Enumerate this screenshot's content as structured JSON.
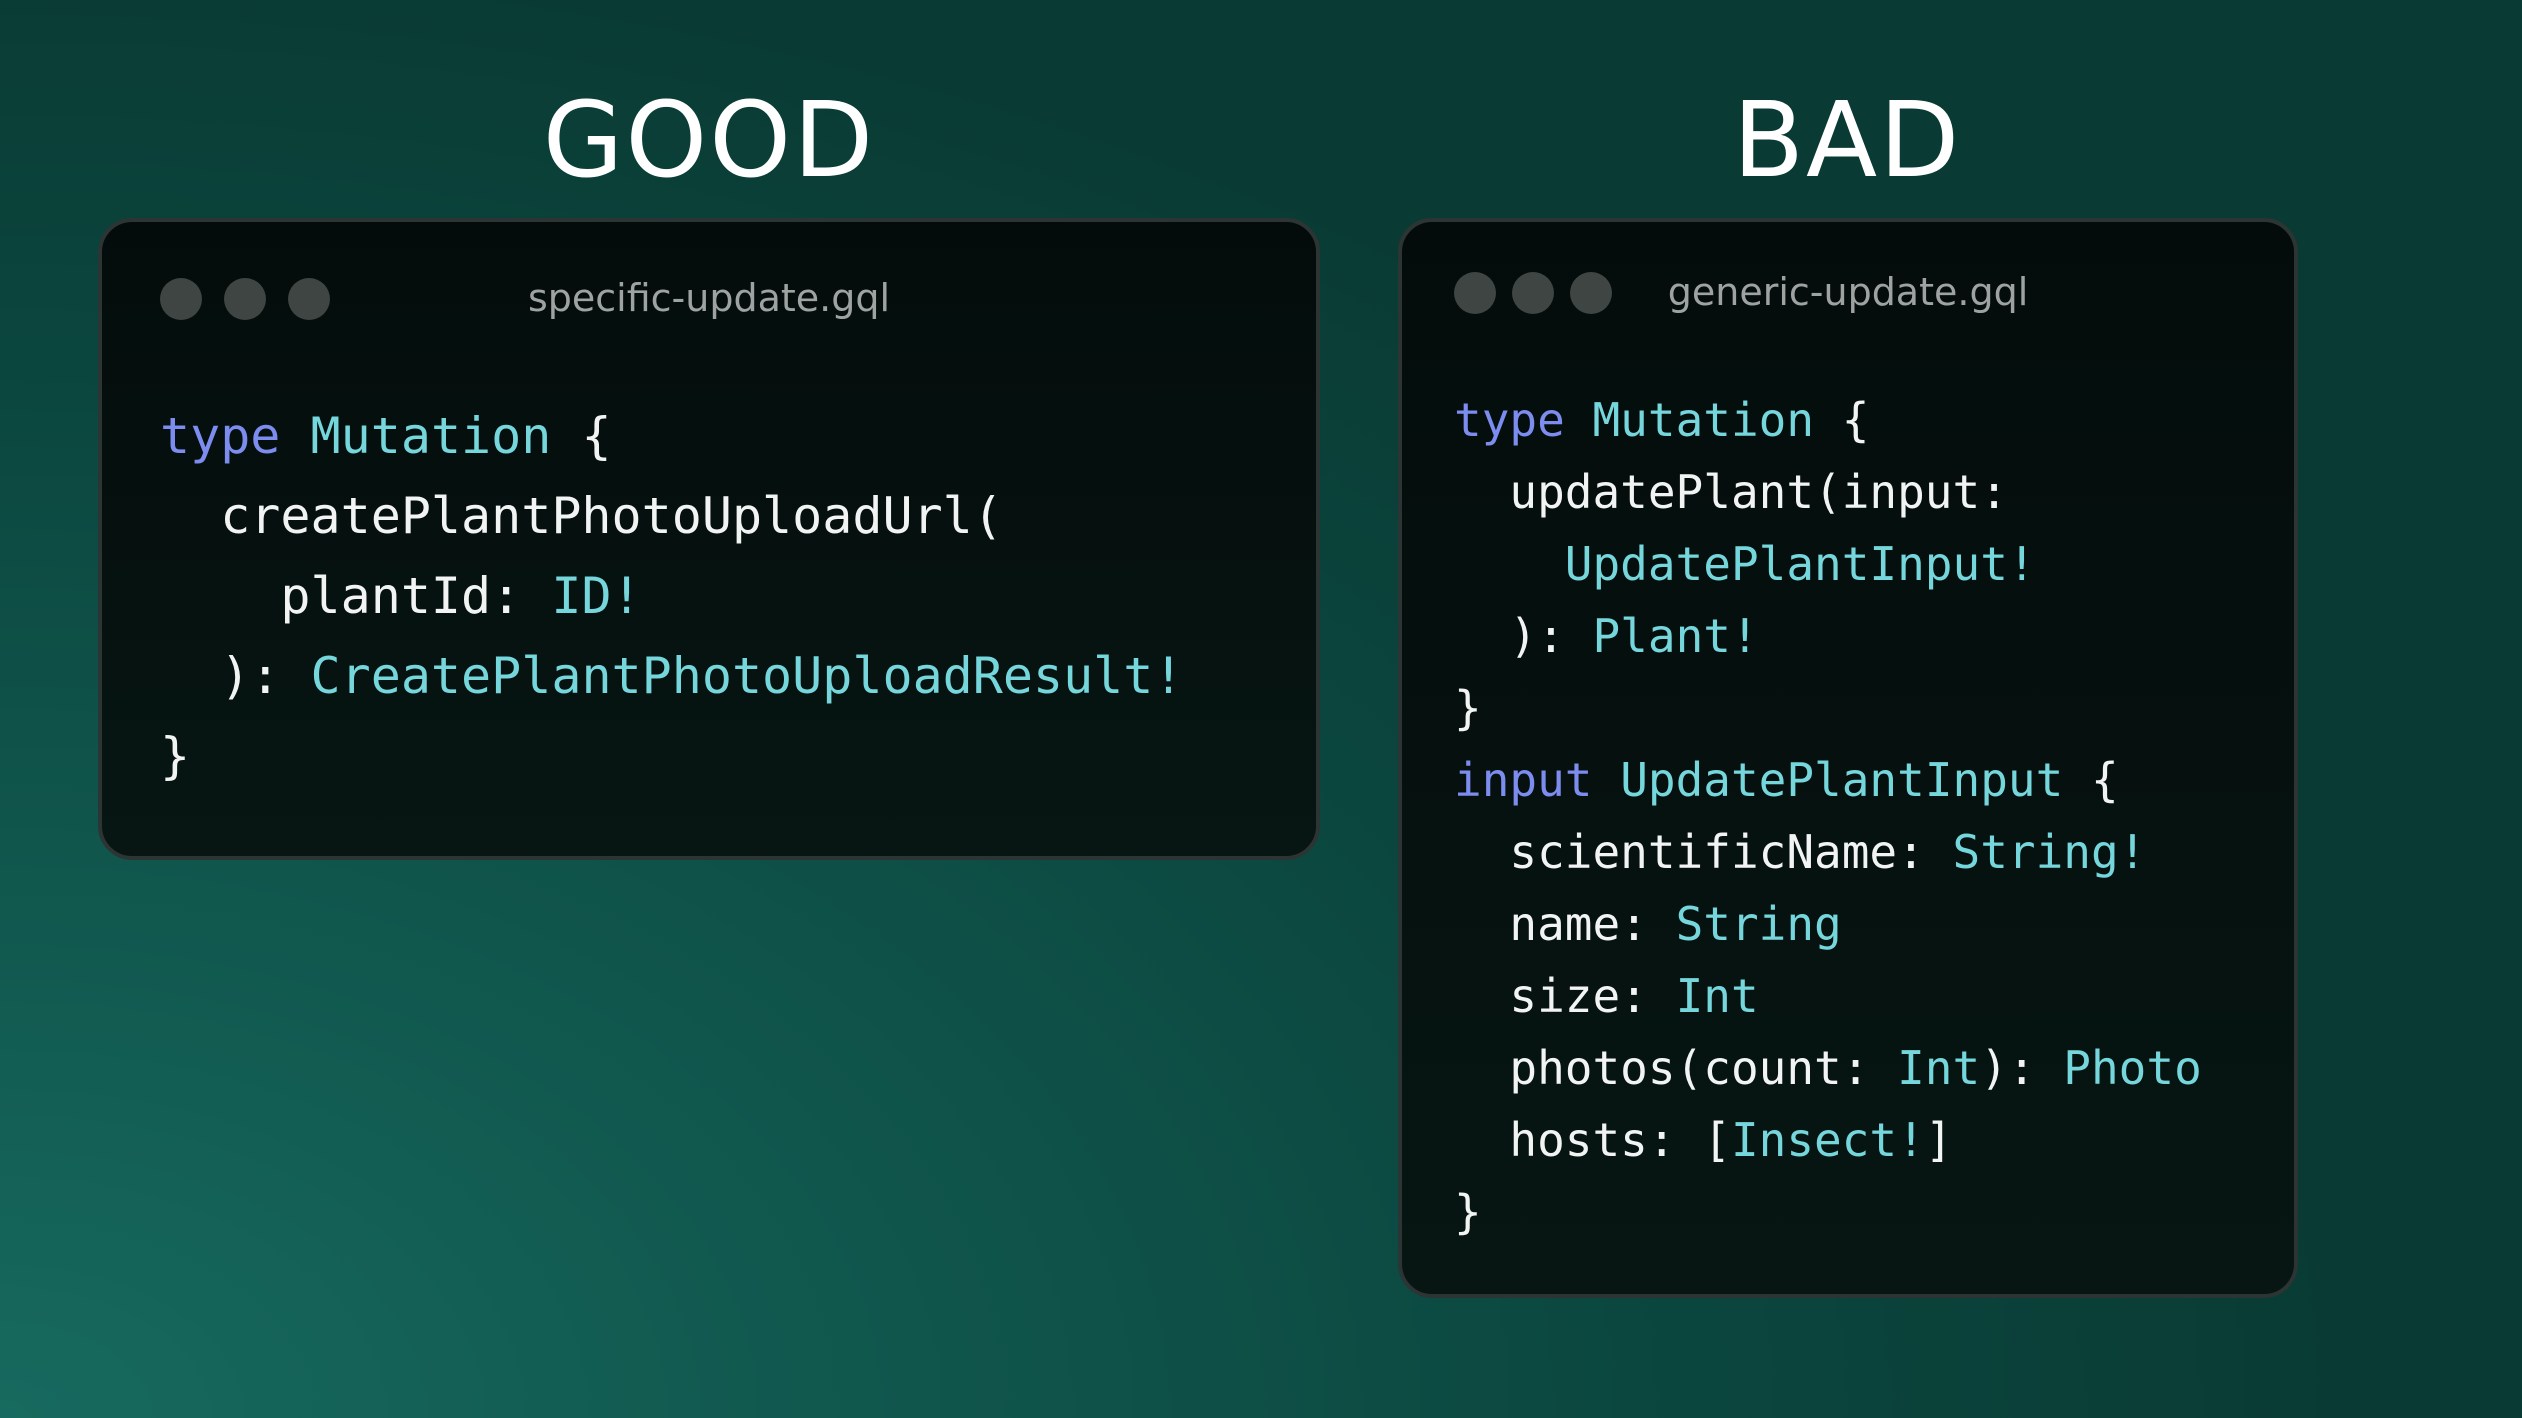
{
  "good": {
    "heading": "GOOD",
    "filename": "specific-update.gql",
    "code": [
      [
        {
          "t": "kw",
          "v": "type"
        },
        {
          "t": "p",
          "v": " "
        },
        {
          "t": "ty",
          "v": "Mutation"
        },
        {
          "t": "p",
          "v": " {"
        }
      ],
      [
        {
          "t": "p",
          "v": "  createPlantPhotoUploadUrl("
        }
      ],
      [
        {
          "t": "p",
          "v": "    plantId: "
        },
        {
          "t": "ty",
          "v": "ID!"
        }
      ],
      [
        {
          "t": "p",
          "v": "  ): "
        },
        {
          "t": "ty",
          "v": "CreatePlantPhotoUploadResult!"
        }
      ],
      [
        {
          "t": "p",
          "v": "}"
        }
      ]
    ]
  },
  "bad": {
    "heading": "BAD",
    "filename": "generic-update.gql",
    "code": [
      [
        {
          "t": "kw",
          "v": "type"
        },
        {
          "t": "p",
          "v": " "
        },
        {
          "t": "ty",
          "v": "Mutation"
        },
        {
          "t": "p",
          "v": " {"
        }
      ],
      [
        {
          "t": "p",
          "v": "  updatePlant(input:"
        }
      ],
      [
        {
          "t": "p",
          "v": "    "
        },
        {
          "t": "ty",
          "v": "UpdatePlantInput!"
        }
      ],
      [
        {
          "t": "p",
          "v": "  ): "
        },
        {
          "t": "ty",
          "v": "Plant!"
        }
      ],
      [
        {
          "t": "p",
          "v": "}"
        }
      ],
      [
        {
          "t": "kw",
          "v": "input"
        },
        {
          "t": "p",
          "v": " "
        },
        {
          "t": "ty",
          "v": "UpdatePlantInput"
        },
        {
          "t": "p",
          "v": " {"
        }
      ],
      [
        {
          "t": "p",
          "v": "  scientificName: "
        },
        {
          "t": "ty",
          "v": "String!"
        }
      ],
      [
        {
          "t": "p",
          "v": "  name: "
        },
        {
          "t": "ty",
          "v": "String"
        }
      ],
      [
        {
          "t": "p",
          "v": "  size: "
        },
        {
          "t": "ty",
          "v": "Int"
        }
      ],
      [
        {
          "t": "p",
          "v": "  photos(count: "
        },
        {
          "t": "ty",
          "v": "Int"
        },
        {
          "t": "p",
          "v": "): "
        },
        {
          "t": "ty",
          "v": "Photo"
        }
      ],
      [
        {
          "t": "p",
          "v": "  hosts: ["
        },
        {
          "t": "ty",
          "v": "Insect!"
        },
        {
          "t": "p",
          "v": "]"
        }
      ],
      [
        {
          "t": "p",
          "v": "}"
        }
      ]
    ]
  },
  "colors": {
    "keyword": "#7c8cef",
    "type": "#75d6dc",
    "plain": "#f2f4f4"
  }
}
